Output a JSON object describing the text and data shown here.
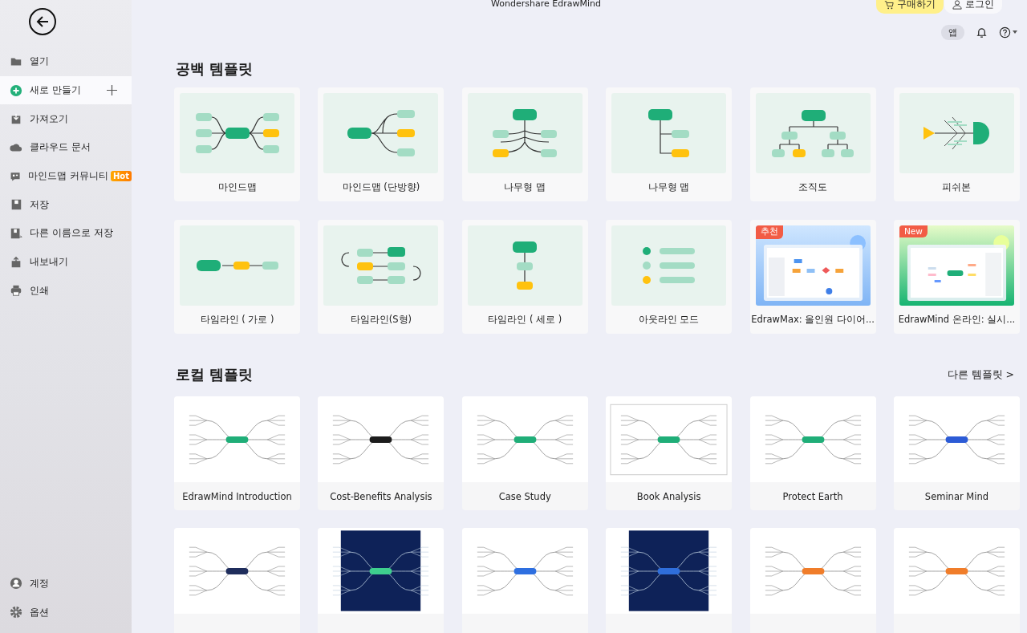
{
  "window": {
    "title": "Wondershare EdrawMind"
  },
  "header": {
    "buy_button": "구매하기",
    "login_button": "로그인",
    "app_button": "앱"
  },
  "sidebar": {
    "items": [
      {
        "label": "열기",
        "selected": false
      },
      {
        "label": "새로 만들기",
        "selected": true,
        "plus": true
      },
      {
        "label": "가져오기",
        "selected": false
      },
      {
        "label": "클라우드 문서",
        "selected": false
      },
      {
        "label": "마인드맵 커뮤니티",
        "selected": false,
        "badge": "Hot"
      },
      {
        "label": "저장",
        "selected": false
      },
      {
        "label": "다른 이름으로 저장",
        "selected": false
      },
      {
        "label": "내보내기",
        "selected": false
      },
      {
        "label": "인쇄",
        "selected": false
      }
    ],
    "bottom_items": [
      {
        "label": "계정",
        "selected": false
      },
      {
        "label": "옵션",
        "selected": false
      }
    ]
  },
  "blank_templates": {
    "title": "공백 템플릿",
    "items": [
      {
        "label": "마인드맵",
        "kind": "mindmap"
      },
      {
        "label": "마인드맵 (단방향)",
        "kind": "rightmap"
      },
      {
        "label": "나무형 맵",
        "kind": "tree"
      },
      {
        "label": "나무형 맵",
        "kind": "treeright"
      },
      {
        "label": "조직도",
        "kind": "org"
      },
      {
        "label": "피쉬본",
        "kind": "fishbone"
      },
      {
        "label": "타임라인 ( 가로 )",
        "kind": "timelineh"
      },
      {
        "label": "타임라인(S형)",
        "kind": "timelines"
      },
      {
        "label": "타임라인 ( 세로 )",
        "kind": "timelinev"
      },
      {
        "label": "아웃라인 모드",
        "kind": "outline"
      },
      {
        "label": "EdrawMax: 올인원 다이어...",
        "kind": "promoflow",
        "badge": "추천"
      },
      {
        "label": "EdrawMind 온라인: 실시...",
        "kind": "promomind",
        "badge": "New"
      }
    ]
  },
  "local_templates": {
    "title": "로컬 템플릿",
    "more_link": "다른 템플릿 >",
    "items": [
      {
        "label": "EdrawMind Introduction",
        "kind": "light"
      },
      {
        "label": "Cost-Benefits Analysis",
        "kind": "light"
      },
      {
        "label": "Case Study",
        "kind": "light"
      },
      {
        "label": "Book Analysis",
        "kind": "framed"
      },
      {
        "label": "Protect Earth",
        "kind": "light"
      },
      {
        "label": "Seminar Mind",
        "kind": "light"
      },
      {
        "kind": "light"
      },
      {
        "kind": "dark"
      },
      {
        "kind": "light"
      },
      {
        "kind": "dark"
      },
      {
        "kind": "light"
      },
      {
        "kind": "light"
      }
    ]
  }
}
